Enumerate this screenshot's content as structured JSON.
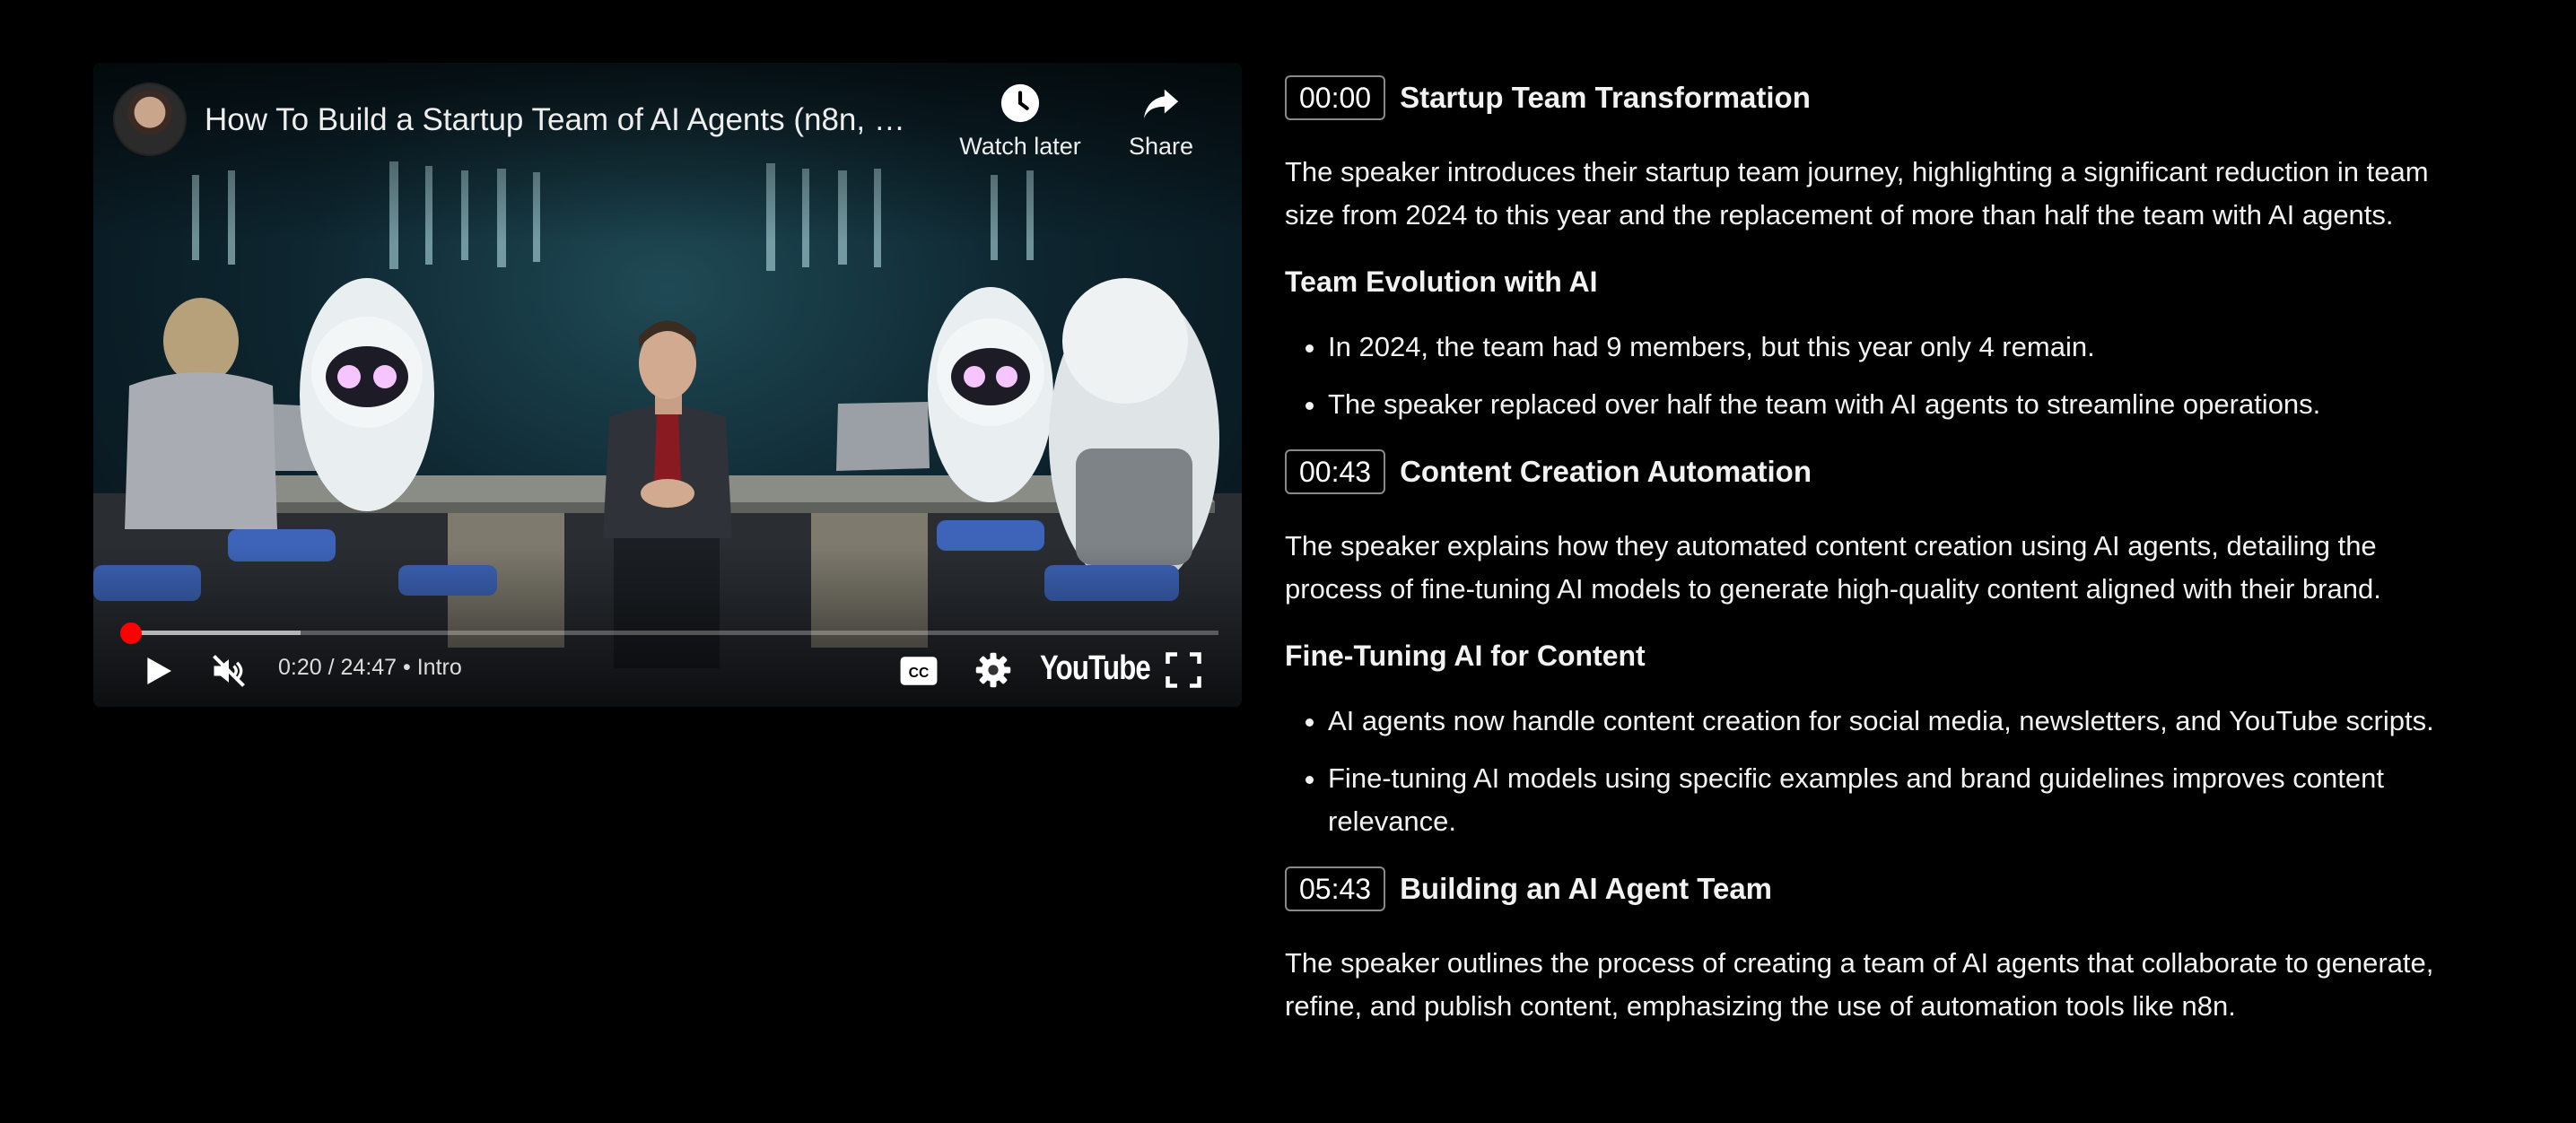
{
  "player": {
    "title": "How To Build a Startup Team of AI Agents (n8n, …",
    "watch_later_label": "Watch later",
    "share_label": "Share",
    "current_time": "0:20",
    "duration": "24:47",
    "time_separator": " / ",
    "chapter_separator": " • ",
    "chapter": "Intro",
    "progress_fraction": 0.014,
    "buffer_fraction": 0.16,
    "logo_text": "YouTube",
    "cc_label": "CC",
    "accent_color": "#ff0000"
  },
  "sections": [
    {
      "timestamp": "00:00",
      "title": "Startup Team Transformation",
      "paragraph": "The speaker introduces their startup team journey, highlighting a significant reduction in team size from 2024 to this year and the replacement of more than half the team with AI agents.",
      "subheading": "Team Evolution with AI",
      "bullets": [
        "In 2024, the team had 9 members, but this year only 4 remain.",
        "The speaker replaced over half the team with AI agents to streamline operations."
      ]
    },
    {
      "timestamp": "00:43",
      "title": "Content Creation Automation",
      "paragraph": "The speaker explains how they automated content creation using AI agents, detailing the process of fine-tuning AI models to generate high-quality content aligned with their brand.",
      "subheading": "Fine-Tuning AI for Content",
      "bullets": [
        "AI agents now handle content creation for social media, newsletters, and YouTube scripts.",
        "Fine-tuning AI models using specific examples and brand guidelines improves content relevance."
      ]
    },
    {
      "timestamp": "05:43",
      "title": "Building an AI Agent Team",
      "paragraph": "The speaker outlines the process of creating a team of AI agents that collaborate to generate, refine, and publish content, emphasizing the use of automation tools like n8n."
    }
  ]
}
